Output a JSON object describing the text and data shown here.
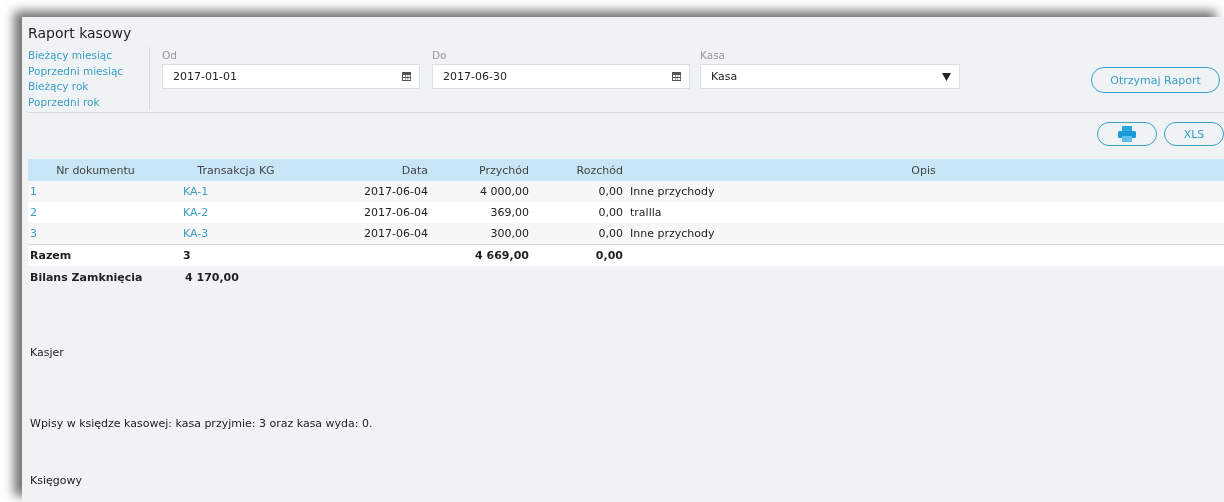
{
  "title": "Raport kasowy",
  "quick_ranges": [
    {
      "label": "Bieżący miesiąc"
    },
    {
      "label": "Poprzedni miesiąc"
    },
    {
      "label": "Bieżący rok"
    },
    {
      "label": "Poprzedni rok"
    }
  ],
  "filters": {
    "from": {
      "label": "Od",
      "value": "2017-01-01"
    },
    "to": {
      "label": "Do",
      "value": "2017-06-30"
    },
    "cash_register": {
      "label": "Kasa",
      "value": "Kasa"
    }
  },
  "get_report_button": "Otrzymaj Raport",
  "export_buttons": [
    {
      "kind": "print"
    },
    {
      "kind": "text",
      "label": "XLS"
    }
  ],
  "table": {
    "columns": [
      "Nr dokumentu",
      "Transakcja KG",
      "Data",
      "Przychód",
      "Rozchód",
      "Opis"
    ],
    "rows": [
      {
        "number": "1",
        "transaction": "KA-1",
        "date": "2017-06-04",
        "income": "4 000,00",
        "expense": "0,00",
        "description": "Inne przychody"
      },
      {
        "number": "2",
        "transaction": "KA-2",
        "date": "2017-06-04",
        "income": "369,00",
        "expense": "0,00",
        "description": "trallla"
      },
      {
        "number": "3",
        "transaction": "KA-3",
        "date": "2017-06-04",
        "income": "300,00",
        "expense": "0,00",
        "description": "Inne przychody"
      }
    ],
    "total": {
      "label": "Razem",
      "count": "3",
      "income": "4 669,00",
      "expense": "0,00"
    }
  },
  "closing_balance": {
    "label": "Bilans Zamknięcia",
    "value": "4 170,00"
  },
  "cashier_label": "Kasjer",
  "summary": "Wpisy w księdze kasowej: kasa przyjmie: 3 oraz kasa wyda: 0.",
  "accountant_label": "Księgowy"
}
